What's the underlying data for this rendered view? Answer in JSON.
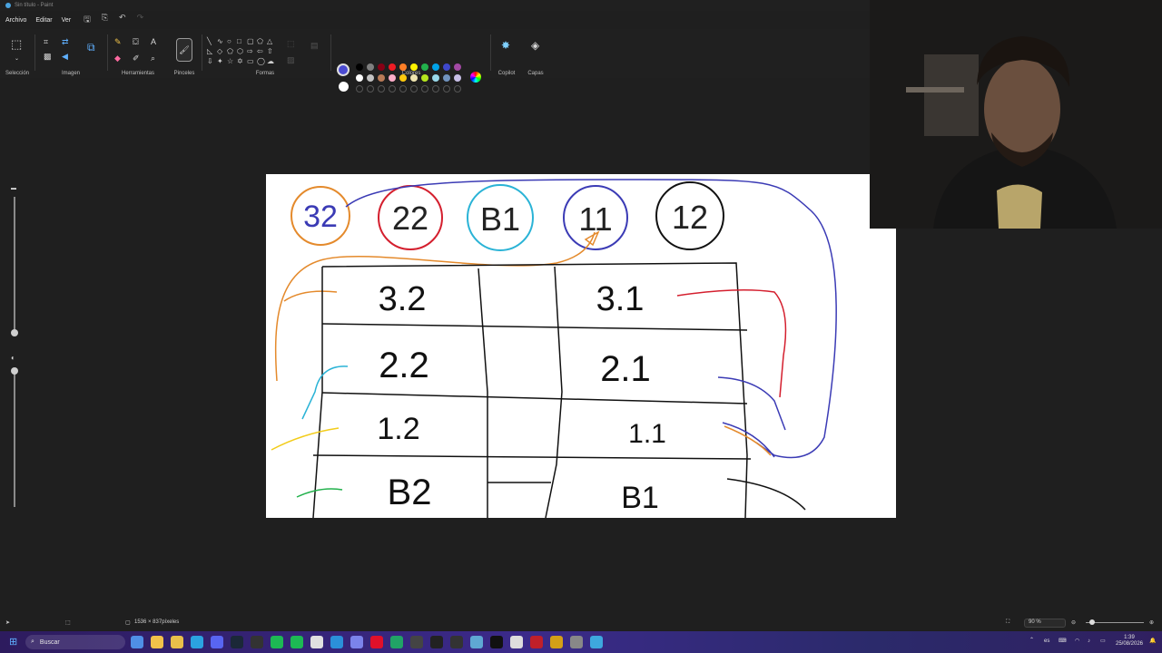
{
  "window": {
    "title": "Sin título - Paint"
  },
  "menu": {
    "file": "Archivo",
    "edit": "Editar",
    "view": "Ver"
  },
  "ribbon": {
    "selection": "Selección",
    "image": "Imagen",
    "tools": "Herramientas",
    "brushes": "Pinceles",
    "shapes": "Formas",
    "colors": "Colores",
    "copilot": "Copilot",
    "layers": "Capas"
  },
  "colors": {
    "primary": "#4b4bd1",
    "secondary": "#ffffff",
    "palette_row1": [
      "#000000",
      "#7f7f7f",
      "#880015",
      "#ed1c24",
      "#ff7f27",
      "#fff200",
      "#22b14c",
      "#00a2e8",
      "#3f48cc",
      "#a349a4"
    ],
    "palette_row2": [
      "#ffffff",
      "#c3c3c3",
      "#b97a57",
      "#ffaec9",
      "#ffc90e",
      "#efe4b0",
      "#b5e61d",
      "#99d9ea",
      "#7092be",
      "#c8bfe7"
    ]
  },
  "canvas": {
    "circles": [
      "32",
      "22",
      "B1",
      "11",
      "12"
    ],
    "table": [
      [
        "3.2",
        "",
        "3.1"
      ],
      [
        "2.2",
        "",
        "2.1"
      ],
      [
        "1.2",
        "",
        "1.1"
      ],
      [
        "B2",
        "",
        "B1"
      ]
    ]
  },
  "status": {
    "dimensions": "1536 × 837píxeles",
    "zoom": "90 %"
  },
  "taskbar": {
    "search_placeholder": "Buscar",
    "time": "1:39",
    "date": "25/08/2026"
  }
}
